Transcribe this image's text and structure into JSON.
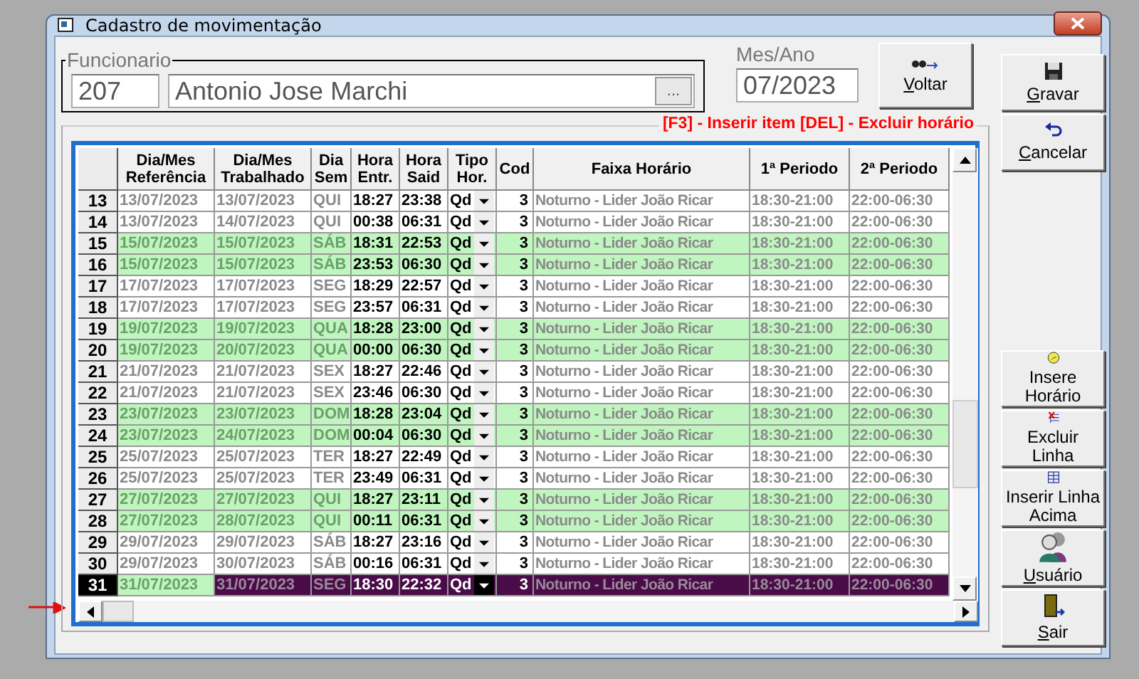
{
  "window": {
    "title": "Cadastro de movimentação"
  },
  "employee": {
    "label": "Funcionario",
    "code": "207",
    "name": "Antonio Jose Marchi",
    "lookup_button": "..."
  },
  "period": {
    "label": "Mes/Ano",
    "value": "07/2023"
  },
  "back_button": {
    "label": "Voltar",
    "mnemonic": true
  },
  "hint": "[F3] - Inserir item [DEL] - Excluir horário",
  "columns": [
    "Dia/Mes Referência",
    "Dia/Mes Trabalhado",
    "Dia Sem",
    "Hora Entr.",
    "Hora Said",
    "Tipo Hor.",
    "Cod",
    "Faixa Horário",
    "1ª Periodo",
    "2ª Periodo"
  ],
  "rows": [
    {
      "num": "13",
      "ref": "13/07/2023",
      "worked": "13/07/2023",
      "weekday": "QUI",
      "in": "18:27",
      "out": "23:38",
      "type": "Qd",
      "cod": "3",
      "range": "Noturno - Lider João Ricar",
      "p1": "18:30-21:00",
      "p2": "22:00-06:30",
      "shaded": false,
      "selected": false
    },
    {
      "num": "14",
      "ref": "13/07/2023",
      "worked": "14/07/2023",
      "weekday": "QUI",
      "in": "00:38",
      "out": "06:31",
      "type": "Qd",
      "cod": "3",
      "range": "Noturno - Lider João Ricar",
      "p1": "18:30-21:00",
      "p2": "22:00-06:30",
      "shaded": false,
      "selected": false
    },
    {
      "num": "15",
      "ref": "15/07/2023",
      "worked": "15/07/2023",
      "weekday": "SÁB",
      "in": "18:31",
      "out": "22:53",
      "type": "Qd",
      "cod": "3",
      "range": "Noturno - Lider João Ricar",
      "p1": "18:30-21:00",
      "p2": "22:00-06:30",
      "shaded": true,
      "selected": false
    },
    {
      "num": "16",
      "ref": "15/07/2023",
      "worked": "15/07/2023",
      "weekday": "SÁB",
      "in": "23:53",
      "out": "06:30",
      "type": "Qd",
      "cod": "3",
      "range": "Noturno - Lider João Ricar",
      "p1": "18:30-21:00",
      "p2": "22:00-06:30",
      "shaded": true,
      "selected": false
    },
    {
      "num": "17",
      "ref": "17/07/2023",
      "worked": "17/07/2023",
      "weekday": "SEG",
      "in": "18:29",
      "out": "22:57",
      "type": "Qd",
      "cod": "3",
      "range": "Noturno - Lider João Ricar",
      "p1": "18:30-21:00",
      "p2": "22:00-06:30",
      "shaded": false,
      "selected": false
    },
    {
      "num": "18",
      "ref": "17/07/2023",
      "worked": "17/07/2023",
      "weekday": "SEG",
      "in": "23:57",
      "out": "06:31",
      "type": "Qd",
      "cod": "3",
      "range": "Noturno - Lider João Ricar",
      "p1": "18:30-21:00",
      "p2": "22:00-06:30",
      "shaded": false,
      "selected": false
    },
    {
      "num": "19",
      "ref": "19/07/2023",
      "worked": "19/07/2023",
      "weekday": "QUA",
      "in": "18:28",
      "out": "23:00",
      "type": "Qd",
      "cod": "3",
      "range": "Noturno - Lider João Ricar",
      "p1": "18:30-21:00",
      "p2": "22:00-06:30",
      "shaded": true,
      "selected": false
    },
    {
      "num": "20",
      "ref": "19/07/2023",
      "worked": "20/07/2023",
      "weekday": "QUA",
      "in": "00:00",
      "out": "06:30",
      "type": "Qd",
      "cod": "3",
      "range": "Noturno - Lider João Ricar",
      "p1": "18:30-21:00",
      "p2": "22:00-06:30",
      "shaded": true,
      "selected": false
    },
    {
      "num": "21",
      "ref": "21/07/2023",
      "worked": "21/07/2023",
      "weekday": "SEX",
      "in": "18:27",
      "out": "22:46",
      "type": "Qd",
      "cod": "3",
      "range": "Noturno - Lider João Ricar",
      "p1": "18:30-21:00",
      "p2": "22:00-06:30",
      "shaded": false,
      "selected": false
    },
    {
      "num": "22",
      "ref": "21/07/2023",
      "worked": "21/07/2023",
      "weekday": "SEX",
      "in": "23:46",
      "out": "06:30",
      "type": "Qd",
      "cod": "3",
      "range": "Noturno - Lider João Ricar",
      "p1": "18:30-21:00",
      "p2": "22:00-06:30",
      "shaded": false,
      "selected": false
    },
    {
      "num": "23",
      "ref": "23/07/2023",
      "worked": "23/07/2023",
      "weekday": "DOM",
      "in": "18:28",
      "out": "23:04",
      "type": "Qd",
      "cod": "3",
      "range": "Noturno - Lider João Ricar",
      "p1": "18:30-21:00",
      "p2": "22:00-06:30",
      "shaded": true,
      "selected": false
    },
    {
      "num": "24",
      "ref": "23/07/2023",
      "worked": "24/07/2023",
      "weekday": "DOM",
      "in": "00:04",
      "out": "06:30",
      "type": "Qd",
      "cod": "3",
      "range": "Noturno - Lider João Ricar",
      "p1": "18:30-21:00",
      "p2": "22:00-06:30",
      "shaded": true,
      "selected": false
    },
    {
      "num": "25",
      "ref": "25/07/2023",
      "worked": "25/07/2023",
      "weekday": "TER",
      "in": "18:27",
      "out": "22:49",
      "type": "Qd",
      "cod": "3",
      "range": "Noturno - Lider João Ricar",
      "p1": "18:30-21:00",
      "p2": "22:00-06:30",
      "shaded": false,
      "selected": false
    },
    {
      "num": "26",
      "ref": "25/07/2023",
      "worked": "25/07/2023",
      "weekday": "TER",
      "in": "23:49",
      "out": "06:31",
      "type": "Qd",
      "cod": "3",
      "range": "Noturno - Lider João Ricar",
      "p1": "18:30-21:00",
      "p2": "22:00-06:30",
      "shaded": false,
      "selected": false
    },
    {
      "num": "27",
      "ref": "27/07/2023",
      "worked": "27/07/2023",
      "weekday": "QUI",
      "in": "18:27",
      "out": "23:11",
      "type": "Qd",
      "cod": "3",
      "range": "Noturno - Lider João Ricar",
      "p1": "18:30-21:00",
      "p2": "22:00-06:30",
      "shaded": true,
      "selected": false
    },
    {
      "num": "28",
      "ref": "27/07/2023",
      "worked": "28/07/2023",
      "weekday": "QUI",
      "in": "00:11",
      "out": "06:31",
      "type": "Qd",
      "cod": "3",
      "range": "Noturno - Lider João Ricar",
      "p1": "18:30-21:00",
      "p2": "22:00-06:30",
      "shaded": true,
      "selected": false
    },
    {
      "num": "29",
      "ref": "29/07/2023",
      "worked": "29/07/2023",
      "weekday": "SÁB",
      "in": "18:27",
      "out": "23:16",
      "type": "Qd",
      "cod": "3",
      "range": "Noturno - Lider João Ricar",
      "p1": "18:30-21:00",
      "p2": "22:00-06:30",
      "shaded": false,
      "selected": false
    },
    {
      "num": "30",
      "ref": "29/07/2023",
      "worked": "30/07/2023",
      "weekday": "SÁB",
      "in": "00:16",
      "out": "06:31",
      "type": "Qd",
      "cod": "3",
      "range": "Noturno - Lider João Ricar",
      "p1": "18:30-21:00",
      "p2": "22:00-06:30",
      "shaded": false,
      "selected": false
    },
    {
      "num": "31",
      "ref": "31/07/2023",
      "worked": "31/07/2023",
      "weekday": "SEG",
      "in": "18:30",
      "out": "22:32",
      "type": "Qd",
      "cod": "3",
      "range": "Noturno - Lider João Ricar",
      "p1": "18:30-21:00",
      "p2": "22:00-06:30",
      "shaded": true,
      "selected": true
    }
  ],
  "side_buttons": [
    {
      "label": "Gravar",
      "kind": "save",
      "mnemonic": true
    },
    {
      "label": "Cancelar",
      "kind": "undo",
      "mnemonic": true
    },
    {
      "label": "Insere Horário",
      "kind": "clock",
      "mnemonic": false
    },
    {
      "label": "Excluir Linha",
      "kind": "delete-row",
      "mnemonic": false
    },
    {
      "label": "Inserir Linha Acima",
      "kind": "insert-row",
      "mnemonic": false
    },
    {
      "label": "Usuário",
      "kind": "users",
      "mnemonic": true
    },
    {
      "label": "Sair",
      "kind": "exit",
      "mnemonic": true
    }
  ]
}
